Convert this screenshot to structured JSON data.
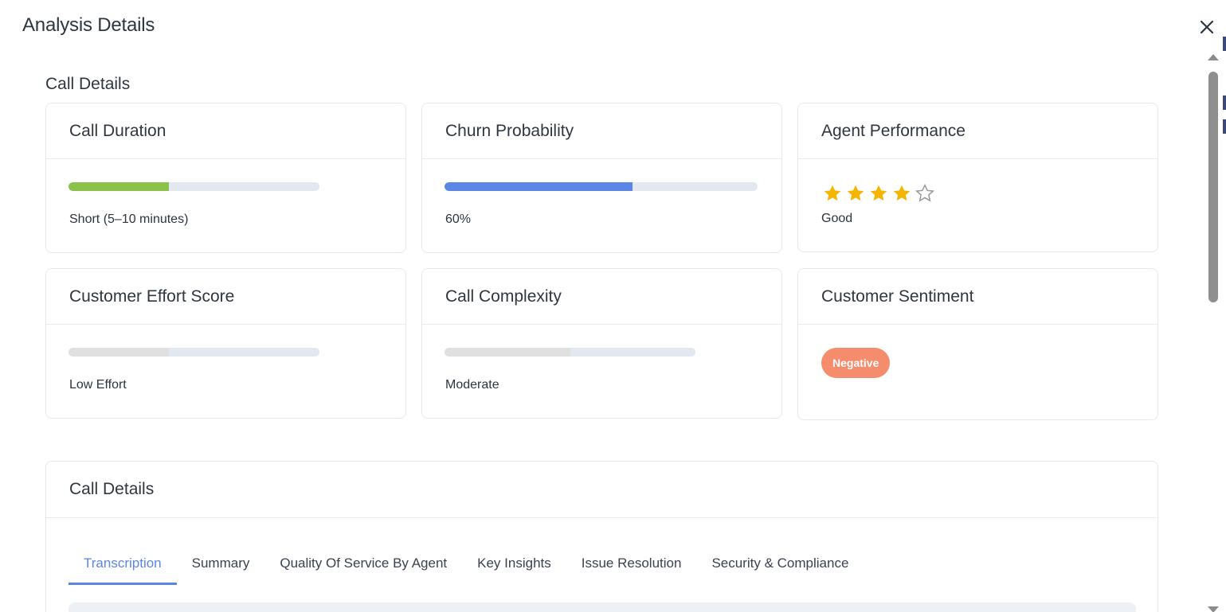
{
  "modal": {
    "title": "Analysis Details"
  },
  "section": {
    "title": "Call Details"
  },
  "cards": {
    "call_duration": {
      "title": "Call Duration",
      "value": "Short (5–10 minutes)",
      "progress": 0.4,
      "color": "#8bc34a"
    },
    "churn_probability": {
      "title": "Churn Probability",
      "value": "60%",
      "progress": 0.6,
      "color": "#5b86e5"
    },
    "agent_performance": {
      "title": "Agent Performance",
      "rating": 4,
      "max_rating": 5,
      "label": "Good",
      "star_color": "#f5b400"
    },
    "customer_effort": {
      "title": "Customer Effort Score",
      "value": "Low Effort",
      "progress": 0.4,
      "color": "#e0e0e0"
    },
    "call_complexity": {
      "title": "Call Complexity",
      "value": "Moderate",
      "progress": 0.5,
      "color": "#e0e0e0"
    },
    "customer_sentiment": {
      "title": "Customer Sentiment",
      "badge": "Negative",
      "badge_color": "#f58c6b"
    }
  },
  "details": {
    "title": "Call Details",
    "tabs": [
      {
        "label": "Transcription",
        "active": true
      },
      {
        "label": "Summary",
        "active": false
      },
      {
        "label": "Quality Of Service By Agent",
        "active": false
      },
      {
        "label": "Key Insights",
        "active": false
      },
      {
        "label": "Issue Resolution",
        "active": false
      },
      {
        "label": "Security & Compliance",
        "active": false
      }
    ]
  }
}
